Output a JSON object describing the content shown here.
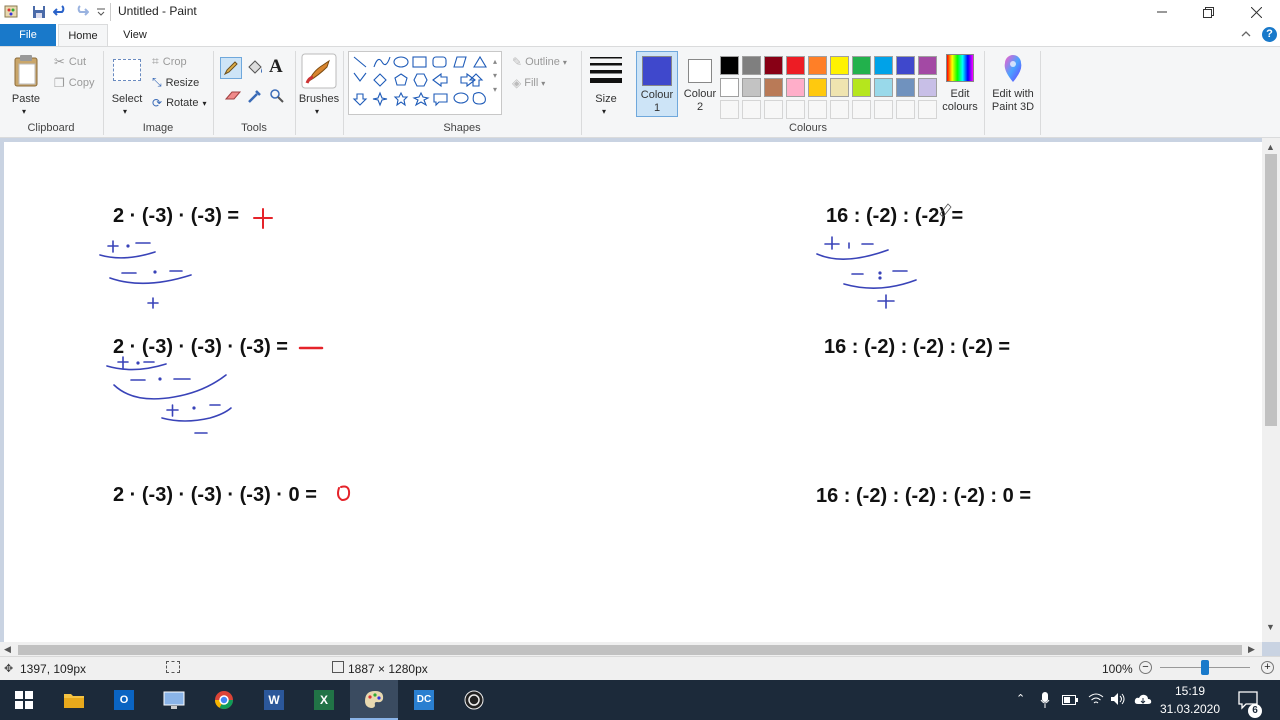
{
  "window": {
    "title": "Untitled - Paint"
  },
  "tabs": {
    "file": "File",
    "home": "Home",
    "view": "View"
  },
  "clipboard": {
    "paste": "Paste",
    "cut": "Cut",
    "copy": "Copy",
    "label": "Clipboard"
  },
  "image": {
    "select": "Select",
    "crop": "Crop",
    "resize": "Resize",
    "rotate": "Rotate",
    "label": "Image"
  },
  "tools": {
    "label": "Tools",
    "brushes": "Brushes"
  },
  "shapes": {
    "outline": "Outline",
    "fill": "Fill",
    "label": "Shapes"
  },
  "size": {
    "label": "Size"
  },
  "colours": {
    "colour1_a": "Colour",
    "colour1_b": "1",
    "colour2_a": "Colour",
    "colour2_b": "2",
    "edit_a": "Edit",
    "edit_b": "colours",
    "paint3d_a": "Edit with",
    "paint3d_b": "Paint 3D",
    "label": "Colours",
    "colour1_value": "#3f48cc",
    "colour2_value": "#ffffff",
    "row1": [
      "#000000",
      "#7f7f7f",
      "#880015",
      "#ed1c24",
      "#ff7f27",
      "#fff200",
      "#22b14c",
      "#00a2e8",
      "#3f48cc",
      "#a349a4"
    ],
    "row2": [
      "#ffffff",
      "#c3c3c3",
      "#b97a57",
      "#ffaec9",
      "#ffc90e",
      "#efe4b0",
      "#b5e61d",
      "#99d9ea",
      "#7092be",
      "#c8bfe7"
    ]
  },
  "canvas": {
    "eq1": "2 · (-3) · (-3) =",
    "eq2": "2 · (-3) · (-3) · (-3) =",
    "eq3": "2 · (-3) · (-3) · (-3) · 0 =",
    "eq4": "16 : (-2) : (-2) =",
    "eq5": "16 : (-2) : (-2) : (-2) =",
    "eq6": "16 : (-2) : (-2) : (-2) : 0 ="
  },
  "status": {
    "cursor": "1397, 109px",
    "dimensions": "1887 × 1280px",
    "zoom": "100%",
    "zoom_level": 0.5
  },
  "taskbar": {
    "time": "15:19",
    "date": "31.03.2020",
    "notifications": "6"
  }
}
